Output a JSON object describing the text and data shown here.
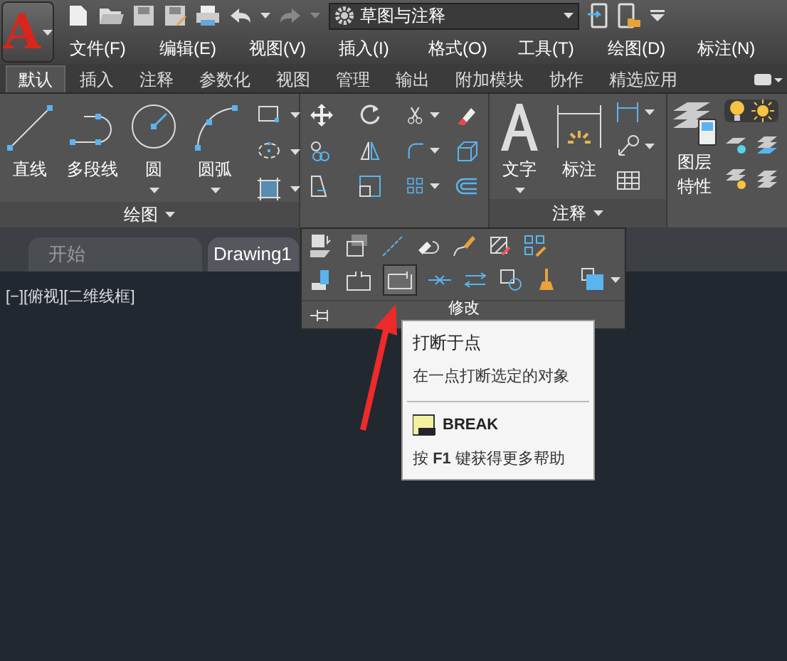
{
  "app_button": {
    "logo": "A"
  },
  "quick_access": {
    "workspace": "草图与注释"
  },
  "menu": [
    "文件(F)",
    "编辑(E)",
    "视图(V)",
    "插入(I)",
    "格式(O)",
    "工具(T)",
    "绘图(D)",
    "标注(N)"
  ],
  "ribbon_tabs": [
    {
      "label": "默认",
      "selected": true
    },
    {
      "label": "插入",
      "selected": false
    },
    {
      "label": "注释",
      "selected": false
    },
    {
      "label": "参数化",
      "selected": false
    },
    {
      "label": "视图",
      "selected": false
    },
    {
      "label": "管理",
      "selected": false
    },
    {
      "label": "输出",
      "selected": false
    },
    {
      "label": "附加模块",
      "selected": false
    },
    {
      "label": "协作",
      "selected": false
    },
    {
      "label": "精选应用",
      "selected": false
    }
  ],
  "draw_panel": {
    "title": "绘图",
    "tools": [
      "直线",
      "多段线",
      "圆",
      "圆弧"
    ]
  },
  "annotation_panel": {
    "title": "注释",
    "tools": [
      "文字",
      "标注"
    ]
  },
  "layers_panel": {
    "tools": [
      "图层特性"
    ]
  },
  "file_tabs": [
    {
      "label": "开始",
      "selected": false
    },
    {
      "label": "Drawing1",
      "selected": true
    }
  ],
  "viewport_label": "[−][俯视][二维线框]",
  "modify_panel": {
    "title": "修改"
  },
  "tooltip": {
    "title": "打断于点",
    "description": "在一点打断选定的对象",
    "command": "BREAK",
    "help": "按 **F1** 键获得更多帮助"
  }
}
